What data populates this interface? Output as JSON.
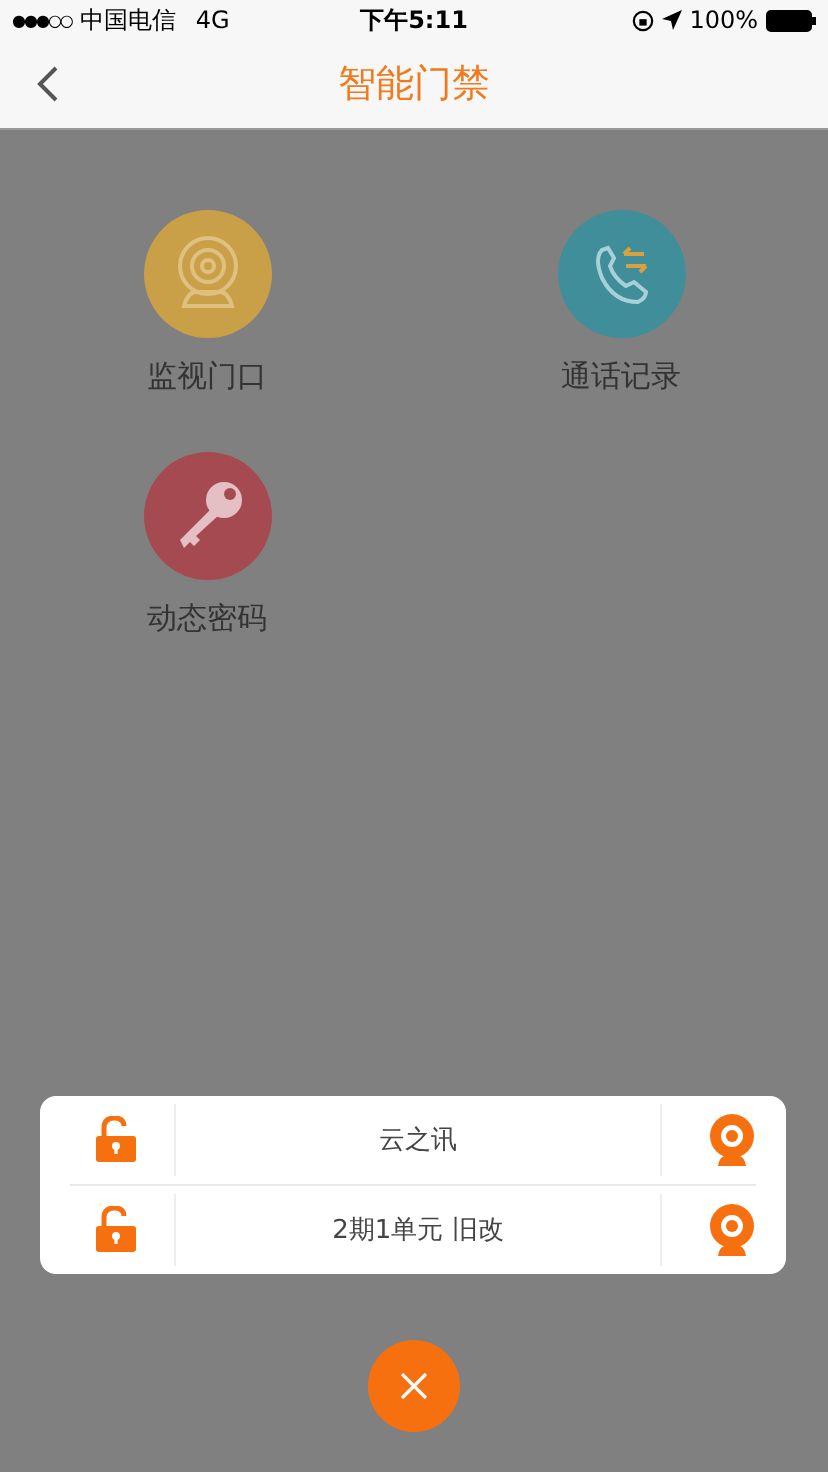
{
  "status_bar": {
    "signal_dots": "●●●○○",
    "carrier": "中国电信",
    "network": "4G",
    "time": "下午5:11",
    "battery": "100%"
  },
  "nav": {
    "title": "智能门禁"
  },
  "features": [
    {
      "kind": "camera",
      "label": "监视门口",
      "color": "#c9a048"
    },
    {
      "kind": "phone",
      "label": "通话记录",
      "color": "#3f8e9a"
    },
    {
      "kind": "key",
      "label": "动态密码",
      "color": "#a64a52"
    }
  ],
  "doors": [
    {
      "name": "云之讯"
    },
    {
      "name": "2期1单元 旧改"
    }
  ]
}
